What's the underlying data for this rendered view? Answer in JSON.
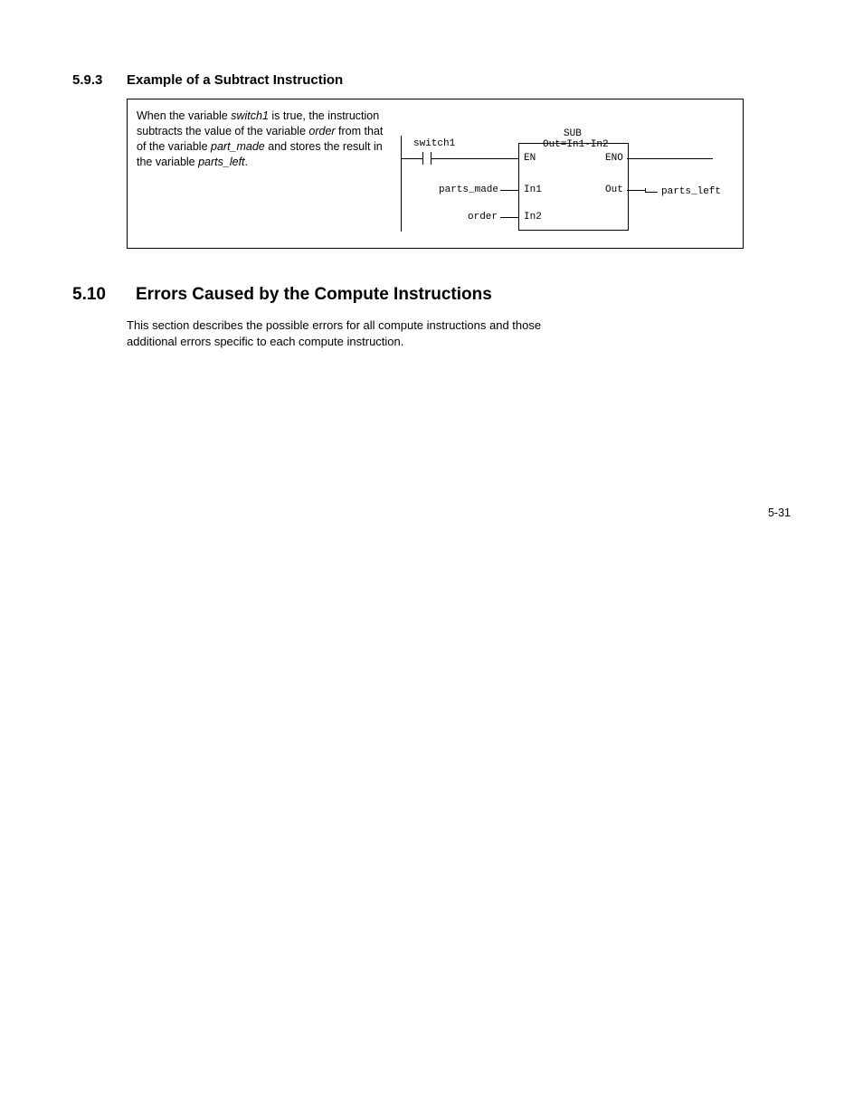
{
  "section1": {
    "number": "5.9.3",
    "title": "Example of a Subtract Instruction",
    "desc_pre": "When the variable ",
    "desc_sw": "switch1",
    "desc_mid1": " is true, the instruction subtracts the value of the variable ",
    "desc_order": "order",
    "desc_mid2": " from that of the variable ",
    "desc_pm": "part_made",
    "desc_mid3": " and stores the result in the variable ",
    "desc_pl": "parts_left",
    "desc_end": "."
  },
  "ladder": {
    "switch_label": "switch1",
    "in1_var": "parts_made",
    "in2_var": "order",
    "out_var": "parts_left",
    "block_title": "SUB",
    "block_expr": "Out=In1-In2",
    "en": "EN",
    "eno": "ENO",
    "in1": "In1",
    "in2": "In2",
    "out": "Out"
  },
  "section2": {
    "number": "5.10",
    "title": "Errors Caused by the Compute Instructions",
    "para": "This section describes the possible errors for all compute instructions and those additional errors specific to each compute instruction."
  },
  "page_number": "5-31"
}
